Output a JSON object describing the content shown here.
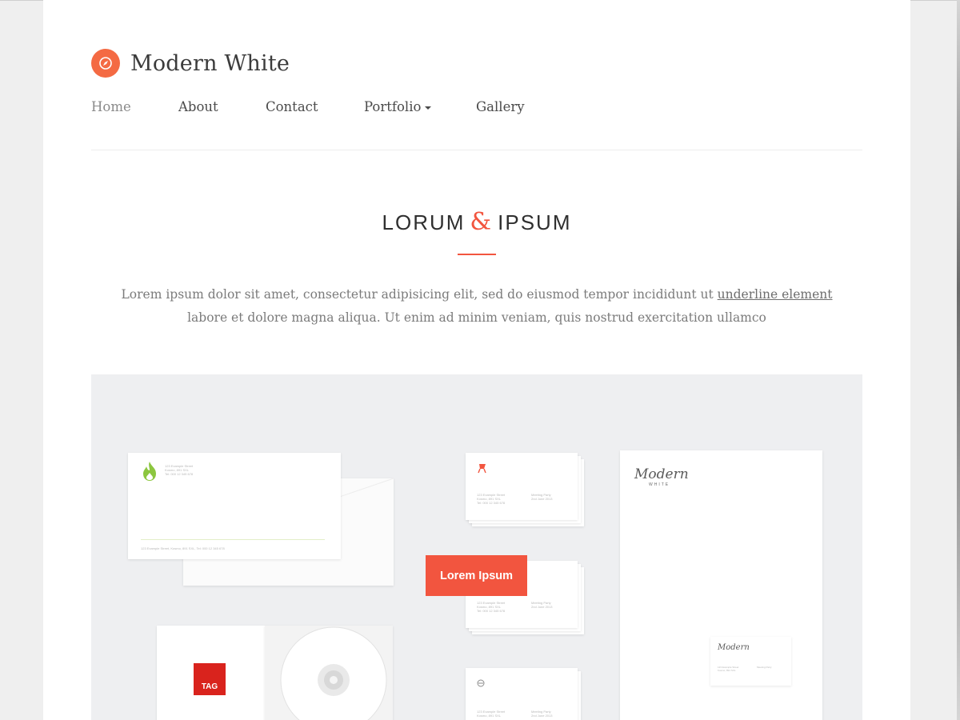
{
  "brand": {
    "title": "Modern White",
    "logo_icon": "compass-icon",
    "accent": "#f46a43"
  },
  "nav": {
    "items": [
      {
        "label": "Home"
      },
      {
        "label": "About"
      },
      {
        "label": "Contact"
      },
      {
        "label": "Portfolio"
      },
      {
        "label": "Gallery"
      }
    ],
    "dropdown_icon": "caret-down-icon"
  },
  "hero": {
    "heading_left": "LORUM",
    "heading_amp": "&",
    "heading_right": "IPSUM",
    "intro_text": "Lorem ipsum dolor sit amet, consectetur adipisicing elit, sed do eiusmod tempor incididunt ut",
    "intro_link": "underline element",
    "intro_text_2": "labore et dolore magna aliqua. Ut enim ad minim veniam, quis nostrud exercitation ullamco",
    "accent_color": "#f2553f"
  },
  "showcase": {
    "button_label": "Lorem Ipsum",
    "tag_label": "TAG",
    "letterhead_logo": "Modern",
    "letterhead_logo_sub": "WHITE",
    "card_logo": "Modern",
    "address_lines": [
      "123 Example Street",
      "Kosmo, 891 SXL",
      "Tel: 000 12 345 678"
    ],
    "footer_line": "123 Example Street, Kosmo, 891 SXL, Tel: 000 12 345 678",
    "meeting_lines": [
      "Meeting Party",
      "2nd June 2013"
    ]
  }
}
